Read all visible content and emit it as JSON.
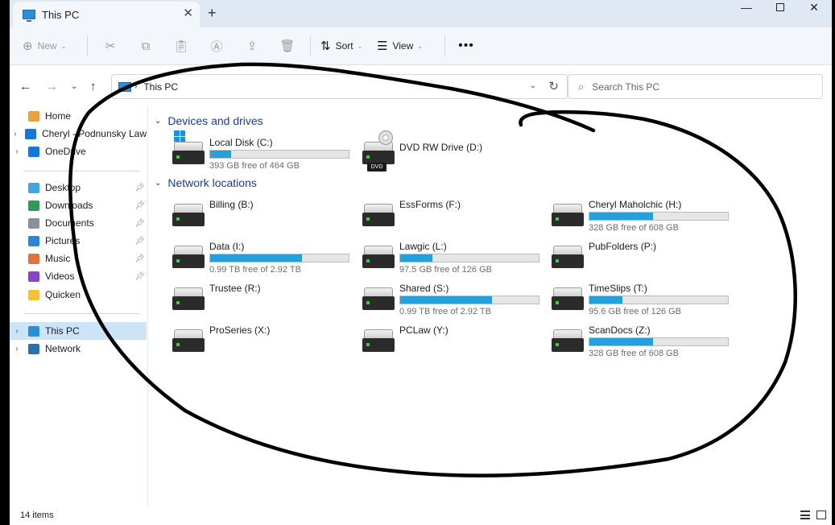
{
  "window": {
    "tab_title": "This PC",
    "new_tab": "+",
    "tab_close": "✕",
    "min": "—",
    "close": "✕"
  },
  "toolbar": {
    "new_label": "New",
    "sort_label": "Sort",
    "view_label": "View",
    "more_label": "•••"
  },
  "address": {
    "path": "This PC",
    "search_placeholder": "Search This PC"
  },
  "sidebar": {
    "items": [
      {
        "label": "Home",
        "chevron": "",
        "icon_color": "#e8a33c",
        "pinned": false
      },
      {
        "label": "Cheryl - Podnunsky Law",
        "chevron": "›",
        "icon_color": "#1478d4",
        "pinned": false
      },
      {
        "label": "OneDrive",
        "chevron": "›",
        "icon_color": "#1478d4",
        "pinned": false
      },
      {
        "label": "Desktop",
        "chevron": "",
        "icon_color": "#3fa6e0",
        "pinned": true
      },
      {
        "label": "Downloads",
        "chevron": "",
        "icon_color": "#2e9b57",
        "pinned": true
      },
      {
        "label": "Documents",
        "chevron": "",
        "icon_color": "#8a8f99",
        "pinned": true
      },
      {
        "label": "Pictures",
        "chevron": "",
        "icon_color": "#2a86d6",
        "pinned": true
      },
      {
        "label": "Music",
        "chevron": "",
        "icon_color": "#e0743a",
        "pinned": true
      },
      {
        "label": "Videos",
        "chevron": "",
        "icon_color": "#8a43c7",
        "pinned": true
      },
      {
        "label": "Quicken",
        "chevron": "",
        "icon_color": "#f2c23b",
        "pinned": false
      },
      {
        "label": "This PC",
        "chevron": "›",
        "icon_color": "#2a8fd6",
        "pinned": false,
        "selected": true
      },
      {
        "label": "Network",
        "chevron": "›",
        "icon_color": "#2a6fb0",
        "pinned": false
      }
    ]
  },
  "groups": {
    "devices": "Devices and drives",
    "network": "Network locations"
  },
  "devices": [
    {
      "name": "Local Disk (C:)",
      "free": "393 GB free of 464 GB",
      "used_fraction": 0.15,
      "type": "windows-disk"
    },
    {
      "name": "DVD RW Drive (D:)",
      "free": "",
      "type": "dvd",
      "dvd_label": "DVD"
    }
  ],
  "network": [
    {
      "name": "Billing (B:)",
      "free": "",
      "used_fraction": null
    },
    {
      "name": "EssForms  (F:)",
      "free": "",
      "used_fraction": null
    },
    {
      "name": "Cheryl Maholchic (H:)",
      "free": "328 GB free of 608 GB",
      "used_fraction": 0.46
    },
    {
      "name": "Data (I:)",
      "free": "0.99 TB free of 2.92 TB",
      "used_fraction": 0.66
    },
    {
      "name": "Lawgic (L:)",
      "free": "97.5 GB free of 126 GB",
      "used_fraction": 0.23
    },
    {
      "name": "PubFolders (P:)",
      "free": "",
      "used_fraction": null
    },
    {
      "name": "Trustee (R:)",
      "free": "",
      "used_fraction": null
    },
    {
      "name": "Shared (S:)",
      "free": "0.99 TB free of 2.92 TB",
      "used_fraction": 0.66
    },
    {
      "name": "TimeSlips (T:)",
      "free": "95.6 GB free of 126 GB",
      "used_fraction": 0.24
    },
    {
      "name": "ProSeries (X:)",
      "free": "",
      "used_fraction": null
    },
    {
      "name": "PCLaw (Y:)",
      "free": "",
      "used_fraction": null
    },
    {
      "name": "ScanDocs (Z:)",
      "free": "328 GB free of 608 GB",
      "used_fraction": 0.46
    }
  ],
  "status": {
    "item_count": "14 items"
  },
  "colors": {
    "accent": "#26a0da",
    "selection": "#cce4f7",
    "group_header": "#1a3d8f"
  }
}
